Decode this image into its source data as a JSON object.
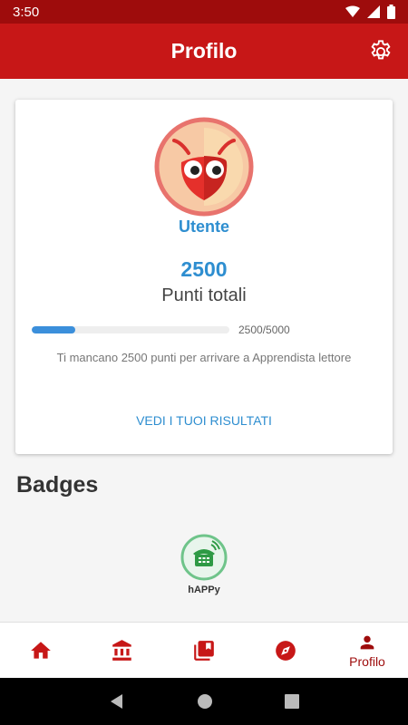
{
  "status_bar": {
    "time": "3:50"
  },
  "app_bar": {
    "title": "Profilo"
  },
  "profile": {
    "username": "Utente",
    "points": "2500",
    "points_label": "Punti totali",
    "progress_text": "2500/5000",
    "progress_fraction": 0.22,
    "missing_text": "Ti mancano 2500 punti per arrivare a Apprendista lettore",
    "results_link": "VEDI I TUOI RISULTATI"
  },
  "badges": {
    "title": "Badges",
    "items": [
      {
        "label": "hAPPy",
        "icon": "phone-icon"
      }
    ]
  },
  "bottom_nav": {
    "items": [
      {
        "icon": "home-icon",
        "label": ""
      },
      {
        "icon": "museum-icon",
        "label": ""
      },
      {
        "icon": "library-icon",
        "label": ""
      },
      {
        "icon": "compass-icon",
        "label": ""
      },
      {
        "icon": "person-icon",
        "label": "Profilo",
        "active": true
      }
    ]
  },
  "colors": {
    "primary": "#c71717",
    "accent": "#2e8ed0",
    "badge_green": "#2e9a45"
  }
}
